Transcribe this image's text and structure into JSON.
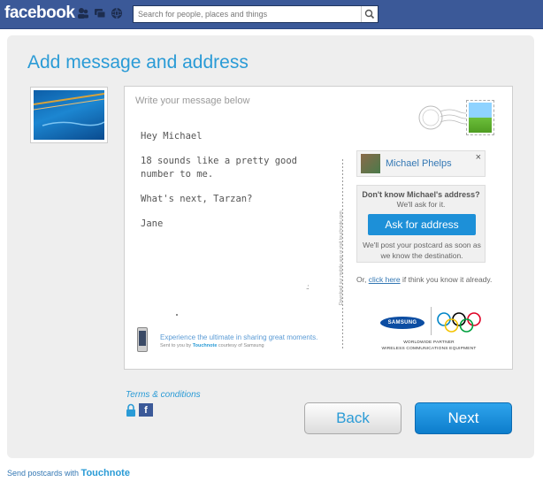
{
  "header": {
    "logo": "facebook",
    "search_placeholder": "Search for people, places and things",
    "icons": [
      "friend-requests-icon",
      "messages-icon",
      "notifications-icon",
      "search-icon"
    ]
  },
  "page": {
    "title": "Add message and address"
  },
  "message": {
    "placeholder": "Write your message below",
    "lines": [
      "Hey Michael",
      "18 sounds like a pretty good number to me.",
      "What's next, Tarzan?",
      "Jane"
    ]
  },
  "divider_text": "Download our mobile app or visit touchnote.com",
  "recipient": {
    "name": "Michael Phelps",
    "close": "×"
  },
  "address_box": {
    "question": "Don't know Michael's address?",
    "subtext": "We'll ask for it.",
    "button": "Ask for address",
    "note": "We'll post your postcard as soon as we know the destination."
  },
  "or_line": {
    "prefix": "Or, ",
    "link": "click here",
    "suffix": " if think you know it already."
  },
  "sponsor": {
    "brand": "SAMSUNG",
    "line1": "WORLDWIDE PARTNER",
    "line2": "WIRELESS COMMUNICATIONS EQUIPMENT"
  },
  "promo": {
    "headline": "Experience the ultimate in sharing great moments.",
    "sub_prefix": "Sent to you by ",
    "sub_brand": "Touchnote",
    "sub_suffix": " courtesy of Samsung"
  },
  "footer_links": {
    "terms": "Terms & conditions"
  },
  "buttons": {
    "back": "Back",
    "next": "Next"
  },
  "footer": {
    "prefix": "Send postcards with ",
    "brand": "Touchnote"
  },
  "colors": {
    "facebook_blue": "#3b5998",
    "accent": "#2a9bd6",
    "next_button": "#1d90d8"
  }
}
